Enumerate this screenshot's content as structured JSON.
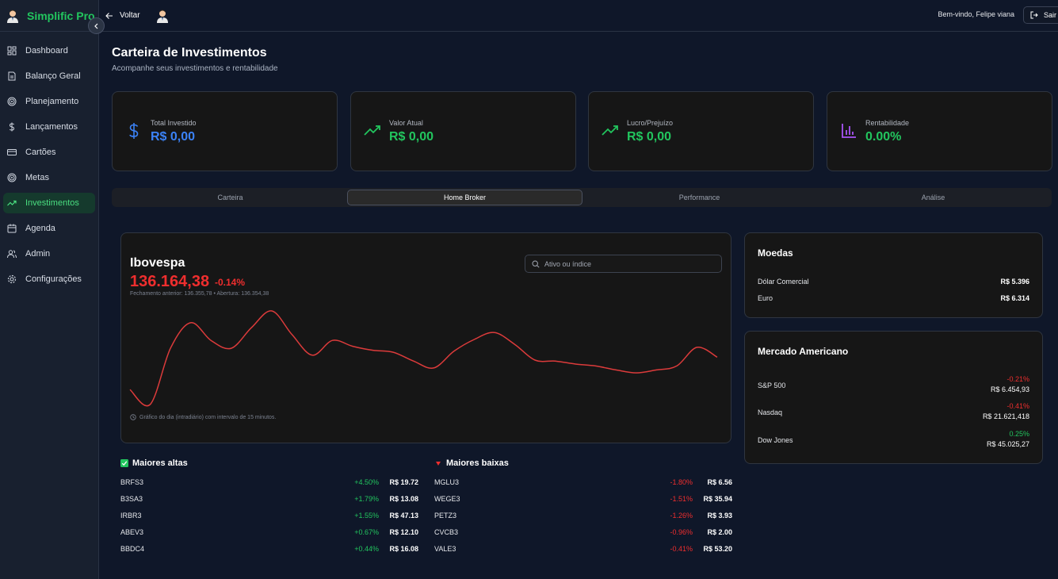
{
  "app": {
    "name": "Simplific Pro"
  },
  "sidebar": {
    "items": [
      {
        "label": "Dashboard",
        "icon": "grid-icon"
      },
      {
        "label": "Balanço Geral",
        "icon": "document-icon"
      },
      {
        "label": "Planejamento",
        "icon": "target-icon"
      },
      {
        "label": "Lançamentos",
        "icon": "dollar-icon"
      },
      {
        "label": "Cartões",
        "icon": "credit-card-icon"
      },
      {
        "label": "Metas",
        "icon": "target-icon"
      },
      {
        "label": "Investimentos",
        "icon": "trending-up-icon",
        "active": true
      },
      {
        "label": "Agenda",
        "icon": "calendar-icon"
      },
      {
        "label": "Admin",
        "icon": "users-icon"
      },
      {
        "label": "Configurações",
        "icon": "gear-icon"
      }
    ]
  },
  "topbar": {
    "back_label": "Voltar",
    "welcome": "Bem-vindo, Felipe viana",
    "logout_label": "Sair"
  },
  "page": {
    "title": "Carteira de Investimentos",
    "subtitle": "Acompanhe seus investimentos e rentabilidade"
  },
  "cards": [
    {
      "label": "Total Investido",
      "value": "R$ 0,00",
      "color": "#3b82f6",
      "icon": "dollar-icon"
    },
    {
      "label": "Valor Atual",
      "value": "R$ 0,00",
      "color": "#22c55e",
      "icon": "trending-up-icon"
    },
    {
      "label": "Lucro/Prejuízo",
      "value": "R$ 0,00",
      "color": "#22c55e",
      "icon": "trending-up-icon"
    },
    {
      "label": "Rentabilidade",
      "value": "0.00%",
      "color": "#22c55e",
      "icon": "bar-chart-icon"
    }
  ],
  "tabs": [
    {
      "label": "Carteira"
    },
    {
      "label": "Home Broker",
      "active": true
    },
    {
      "label": "Performance"
    },
    {
      "label": "Análise"
    }
  ],
  "index": {
    "name": "Ibovespa",
    "value": "136.164,38",
    "change": "-0.14%",
    "previous": "Fechamento anterior: 136.355,78 • Abertura: 136.354,38",
    "search_placeholder": "Ativo ou índice",
    "note": "Gráfico do dia (intradiário) com intervalo de 15 minutos."
  },
  "chart_data": {
    "type": "line",
    "title": "Ibovespa",
    "xlabel": "",
    "ylabel": "",
    "grid": false,
    "series": [
      {
        "values": [
          0.2,
          0.05,
          0.62,
          0.88,
          0.7,
          0.62,
          0.83,
          1.0,
          0.76,
          0.55,
          0.7,
          0.64,
          0.6,
          0.58,
          0.49,
          0.42,
          0.59,
          0.71,
          0.78,
          0.66,
          0.5,
          0.49,
          0.46,
          0.44,
          0.4,
          0.37,
          0.4,
          0.44,
          0.63,
          0.53
        ]
      }
    ],
    "x": [
      0,
      1,
      2,
      3,
      4,
      5,
      6,
      7,
      8,
      9,
      10,
      11,
      12,
      13,
      14,
      15,
      16,
      17,
      18,
      19,
      20,
      21,
      22,
      23,
      24,
      25,
      26,
      27,
      28,
      29
    ],
    "color": "#dc3b3b"
  },
  "gainers": {
    "title": "Maiores altas",
    "items": [
      {
        "ticker": "BRFS3",
        "change": "+4.50%",
        "price": "R$ 19.72"
      },
      {
        "ticker": "B3SA3",
        "change": "+1.79%",
        "price": "R$ 13.08"
      },
      {
        "ticker": "IRBR3",
        "change": "+1.55%",
        "price": "R$ 47.13"
      },
      {
        "ticker": "ABEV3",
        "change": "+0.67%",
        "price": "R$ 12.10"
      },
      {
        "ticker": "BBDC4",
        "change": "+0.44%",
        "price": "R$ 16.08"
      }
    ]
  },
  "losers": {
    "title": "Maiores baixas",
    "items": [
      {
        "ticker": "MGLU3",
        "change": "-1.80%",
        "price": "R$ 6.56"
      },
      {
        "ticker": "WEGE3",
        "change": "-1.51%",
        "price": "R$ 35.94"
      },
      {
        "ticker": "PETZ3",
        "change": "-1.26%",
        "price": "R$ 3.93"
      },
      {
        "ticker": "CVCB3",
        "change": "-0.96%",
        "price": "R$ 2.00"
      },
      {
        "ticker": "VALE3",
        "change": "-0.41%",
        "price": "R$ 53.20"
      }
    ]
  },
  "currencies": {
    "title": "Moedas",
    "items": [
      {
        "name": "Dólar Comercial",
        "value": "R$ 5.396"
      },
      {
        "name": "Euro",
        "value": "R$ 6.314"
      }
    ]
  },
  "us_market": {
    "title": "Mercado Americano",
    "items": [
      {
        "name": "S&P 500",
        "change": "-0.21%",
        "value": "R$ 6.454,93"
      },
      {
        "name": "Nasdaq",
        "change": "-0.41%",
        "value": "R$ 21.621,418"
      },
      {
        "name": "Dow Jones",
        "change": "0.25%",
        "value": "R$ 45.025,27"
      }
    ]
  },
  "colors": {
    "green": "#22c55e",
    "red": "#ef2e2e",
    "blue": "#3b82f6",
    "purple": "#a855f7"
  }
}
